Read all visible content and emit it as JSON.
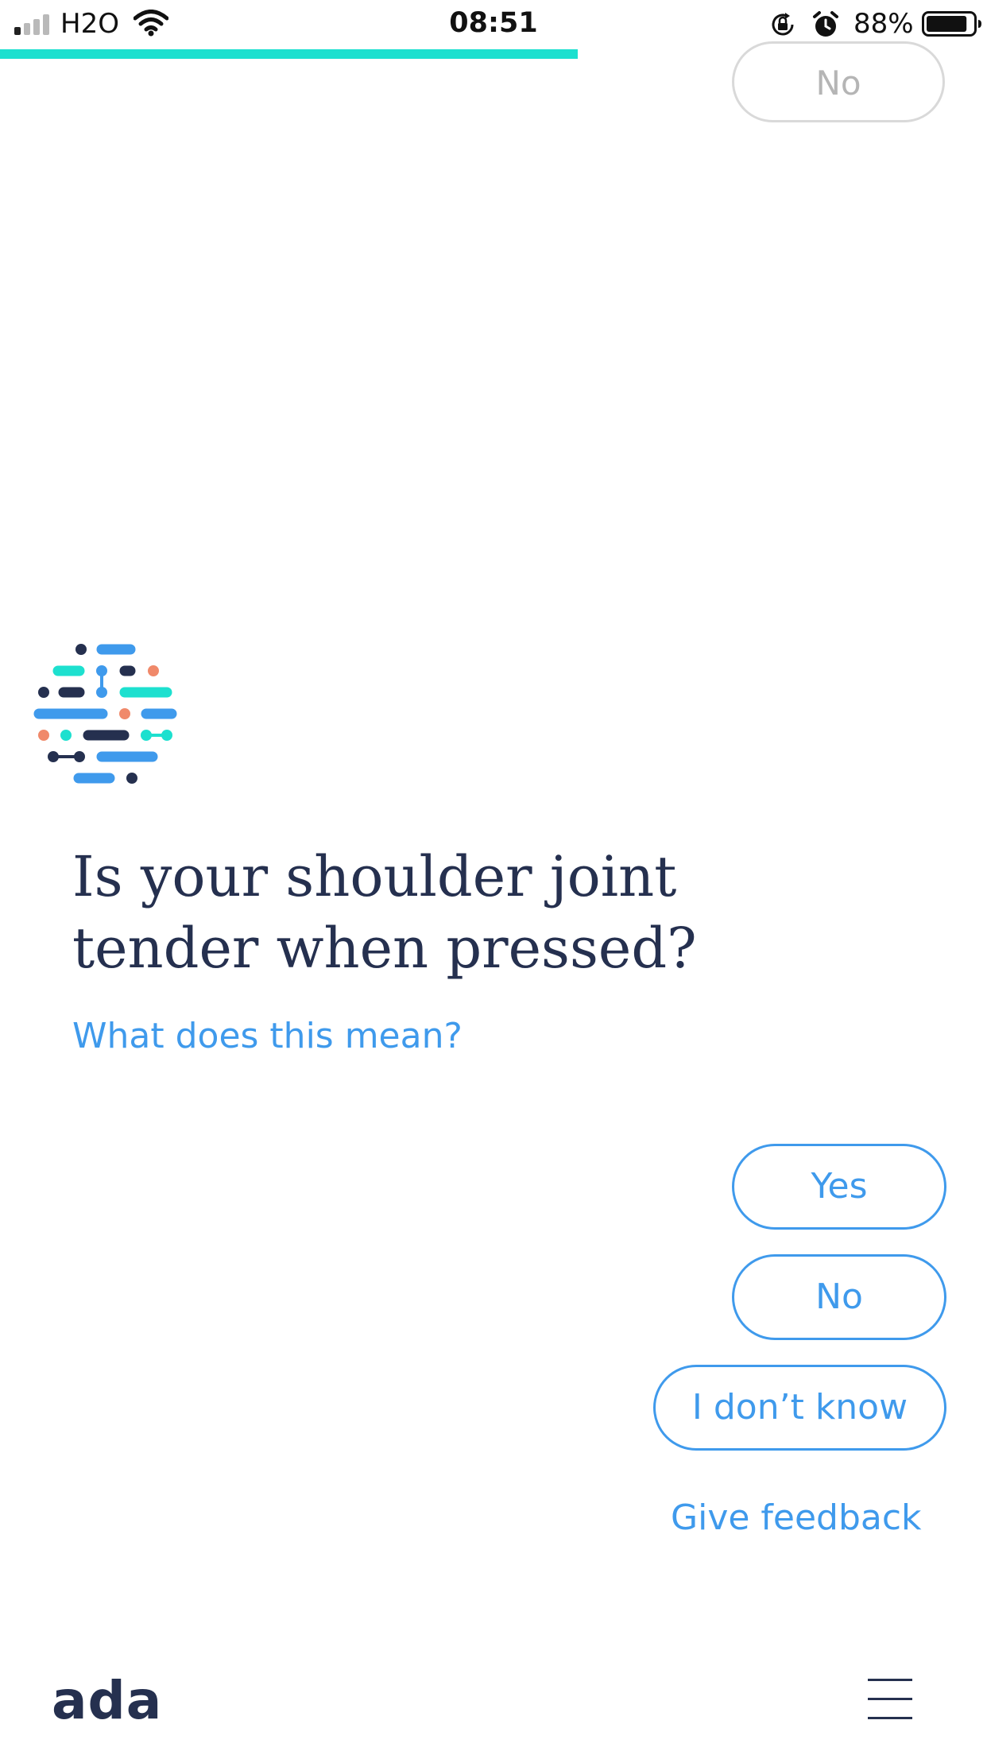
{
  "status_bar": {
    "carrier": "H2O",
    "time": "08:51",
    "battery_percent": "88%",
    "battery_level": 0.88,
    "signal_bars_on": 1,
    "signal_bars_total": 4
  },
  "progress": {
    "fraction": 0.585,
    "color": "#1de0cf"
  },
  "previous_answer": {
    "label": "No"
  },
  "question": {
    "text": "Is your shoulder joint tender when pressed?",
    "help_link": "What does this mean?"
  },
  "answers": [
    {
      "label": "Yes"
    },
    {
      "label": "No"
    },
    {
      "label": "I don’t know"
    }
  ],
  "feedback_link": "Give feedback",
  "footer": {
    "logo_text": "ada"
  },
  "colors": {
    "accent": "#3f9aec",
    "navy": "#25304f",
    "teal": "#1de0cf",
    "coral": "#f0896a",
    "blue": "#3f9aec"
  }
}
